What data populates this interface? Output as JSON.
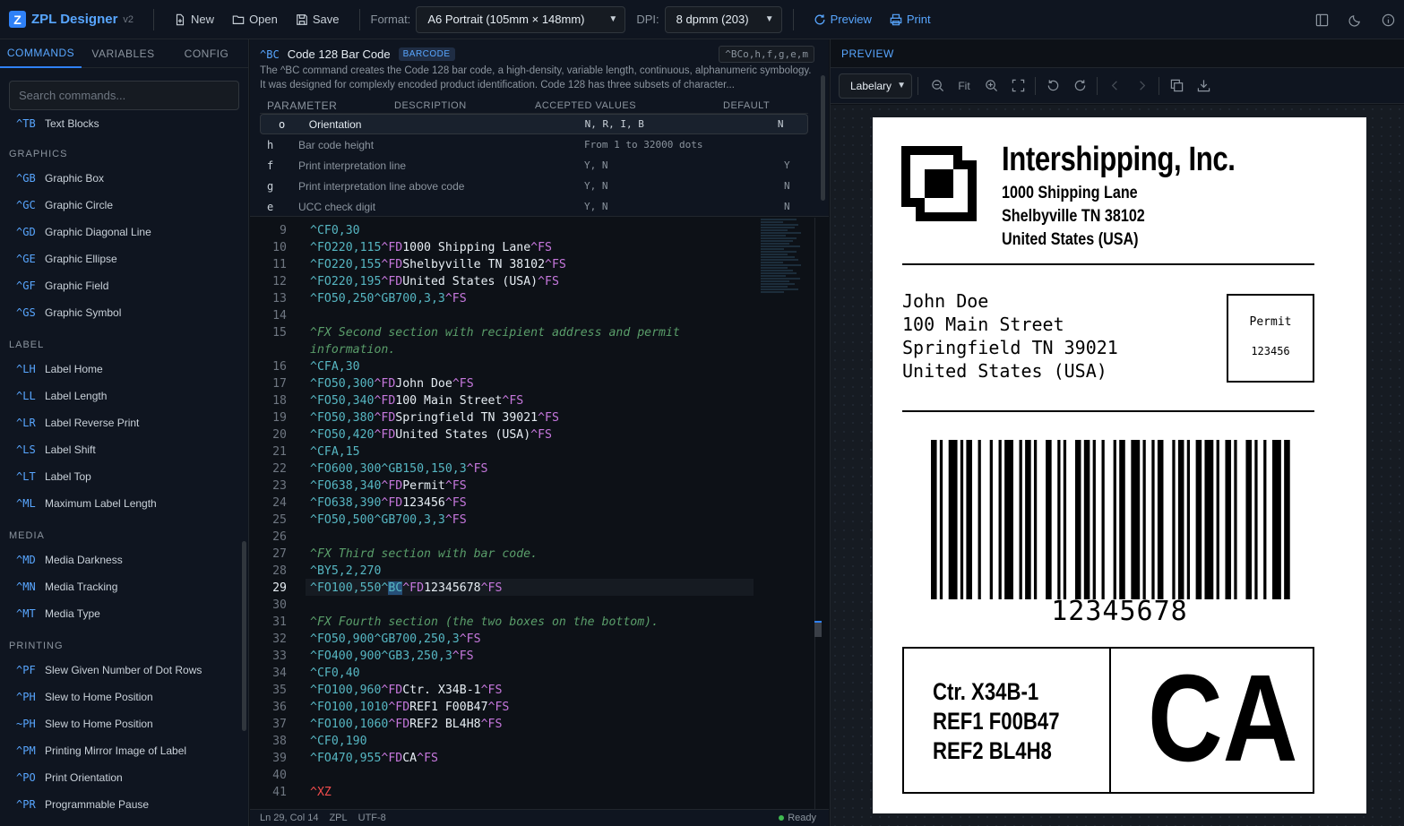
{
  "app": {
    "name": "ZPL Designer",
    "version": "v2"
  },
  "toolbar": {
    "new": "New",
    "open": "Open",
    "save": "Save",
    "format_label": "Format:",
    "format_value": "A6 Portrait (105mm × 148mm)",
    "dpi_label": "DPI:",
    "dpi_value": "8 dpmm (203)",
    "preview": "Preview",
    "print": "Print"
  },
  "sidebar": {
    "tabs": [
      "COMMANDS",
      "VARIABLES",
      "CONFIG"
    ],
    "search_placeholder": "Search commands...",
    "top_item": {
      "code": "^TB",
      "name": "Text Blocks"
    },
    "sections": [
      {
        "title": "GRAPHICS",
        "items": [
          {
            "code": "^GB",
            "name": "Graphic Box"
          },
          {
            "code": "^GC",
            "name": "Graphic Circle"
          },
          {
            "code": "^GD",
            "name": "Graphic Diagonal Line"
          },
          {
            "code": "^GE",
            "name": "Graphic Ellipse"
          },
          {
            "code": "^GF",
            "name": "Graphic Field"
          },
          {
            "code": "^GS",
            "name": "Graphic Symbol"
          }
        ]
      },
      {
        "title": "LABEL",
        "items": [
          {
            "code": "^LH",
            "name": "Label Home"
          },
          {
            "code": "^LL",
            "name": "Label Length"
          },
          {
            "code": "^LR",
            "name": "Label Reverse Print"
          },
          {
            "code": "^LS",
            "name": "Label Shift"
          },
          {
            "code": "^LT",
            "name": "Label Top"
          },
          {
            "code": "^ML",
            "name": "Maximum Label Length"
          }
        ]
      },
      {
        "title": "MEDIA",
        "items": [
          {
            "code": "^MD",
            "name": "Media Darkness"
          },
          {
            "code": "^MN",
            "name": "Media Tracking"
          },
          {
            "code": "^MT",
            "name": "Media Type"
          }
        ]
      },
      {
        "title": "PRINTING",
        "items": [
          {
            "code": "^PF",
            "name": "Slew Given Number of Dot Rows"
          },
          {
            "code": "^PH",
            "name": "Slew to Home Position"
          },
          {
            "code": "~PH",
            "name": "Slew to Home Position"
          },
          {
            "code": "^PM",
            "name": "Printing Mirror Image of Label"
          },
          {
            "code": "^PO",
            "name": "Print Orientation"
          },
          {
            "code": "^PR",
            "name": "Programmable Pause"
          }
        ]
      }
    ]
  },
  "doc": {
    "code": "^BC",
    "title": "Code 128 Bar Code",
    "badge": "BARCODE",
    "signature": "^BCo,h,f,g,e,m",
    "description": "The ^BC command creates the Code 128 bar code, a high-density, variable length, continuous, alphanumeric symbology. It was designed for complexly encoded product identification. Code 128 has three subsets of character...",
    "headers": [
      "PARAMETER",
      "DESCRIPTION",
      "ACCEPTED VALUES",
      "DEFAULT"
    ],
    "params": [
      {
        "p": "o",
        "d": "Orientation",
        "v": "N, R, I, B",
        "def": "N"
      },
      {
        "p": "h",
        "d": "Bar code height",
        "v": "From 1 to 32000 dots",
        "def": ""
      },
      {
        "p": "f",
        "d": "Print interpretation line",
        "v": "Y, N",
        "def": "Y"
      },
      {
        "p": "g",
        "d": "Print interpretation line above code",
        "v": "Y, N",
        "def": "N"
      },
      {
        "p": "e",
        "d": "UCC check digit",
        "v": "Y, N",
        "def": "N"
      }
    ]
  },
  "editor": {
    "lines": [
      {
        "n": "9",
        "segs": [
          [
            "kw",
            "^CF0,30"
          ]
        ]
      },
      {
        "n": "10",
        "segs": [
          [
            "kw",
            "^FO220,115"
          ],
          [
            "tk",
            "^FD"
          ],
          [
            "nm",
            "1000 Shipping Lane"
          ],
          [
            "tk",
            "^FS"
          ]
        ]
      },
      {
        "n": "11",
        "segs": [
          [
            "kw",
            "^FO220,155"
          ],
          [
            "tk",
            "^FD"
          ],
          [
            "nm",
            "Shelbyville TN 38102"
          ],
          [
            "tk",
            "^FS"
          ]
        ]
      },
      {
        "n": "12",
        "segs": [
          [
            "kw",
            "^FO220,195"
          ],
          [
            "tk",
            "^FD"
          ],
          [
            "nm",
            "United States (USA)"
          ],
          [
            "tk",
            "^FS"
          ]
        ]
      },
      {
        "n": "13",
        "segs": [
          [
            "kw",
            "^FO50,250^GB700,3,3"
          ],
          [
            "tk",
            "^FS"
          ]
        ]
      },
      {
        "n": "14",
        "segs": []
      },
      {
        "n": "15",
        "segs": [
          [
            "cm",
            "^FX Second section with recipient address and permit"
          ]
        ]
      },
      {
        "n": "",
        "segs": [
          [
            "cm",
            "information."
          ]
        ]
      },
      {
        "n": "16",
        "segs": [
          [
            "kw",
            "^CFA,30"
          ]
        ]
      },
      {
        "n": "17",
        "segs": [
          [
            "kw",
            "^FO50,300"
          ],
          [
            "tk",
            "^FD"
          ],
          [
            "nm",
            "John Doe"
          ],
          [
            "tk",
            "^FS"
          ]
        ]
      },
      {
        "n": "18",
        "segs": [
          [
            "kw",
            "^FO50,340"
          ],
          [
            "tk",
            "^FD"
          ],
          [
            "nm",
            "100 Main Street"
          ],
          [
            "tk",
            "^FS"
          ]
        ]
      },
      {
        "n": "19",
        "segs": [
          [
            "kw",
            "^FO50,380"
          ],
          [
            "tk",
            "^FD"
          ],
          [
            "nm",
            "Springfield TN 39021"
          ],
          [
            "tk",
            "^FS"
          ]
        ]
      },
      {
        "n": "20",
        "segs": [
          [
            "kw",
            "^FO50,420"
          ],
          [
            "tk",
            "^FD"
          ],
          [
            "nm",
            "United States (USA)"
          ],
          [
            "tk",
            "^FS"
          ]
        ]
      },
      {
        "n": "21",
        "segs": [
          [
            "kw",
            "^CFA,15"
          ]
        ]
      },
      {
        "n": "22",
        "segs": [
          [
            "kw",
            "^FO600,300^GB150,150,3"
          ],
          [
            "tk",
            "^FS"
          ]
        ]
      },
      {
        "n": "23",
        "segs": [
          [
            "kw",
            "^FO638,340"
          ],
          [
            "tk",
            "^FD"
          ],
          [
            "nm",
            "Permit"
          ],
          [
            "tk",
            "^FS"
          ]
        ]
      },
      {
        "n": "24",
        "segs": [
          [
            "kw",
            "^FO638,390"
          ],
          [
            "tk",
            "^FD"
          ],
          [
            "nm",
            "123456"
          ],
          [
            "tk",
            "^FS"
          ]
        ]
      },
      {
        "n": "25",
        "segs": [
          [
            "kw",
            "^FO50,500^GB700,3,3"
          ],
          [
            "tk",
            "^FS"
          ]
        ]
      },
      {
        "n": "26",
        "segs": []
      },
      {
        "n": "27",
        "segs": [
          [
            "cm",
            "^FX Third section with bar code."
          ]
        ]
      },
      {
        "n": "28",
        "segs": [
          [
            "kw",
            "^BY5,2,270"
          ]
        ]
      },
      {
        "n": "29",
        "segs": [
          [
            "kw",
            "^FO100,550^"
          ],
          [
            "kw",
            "BC"
          ],
          [
            "tk",
            "^FD"
          ],
          [
            "nm",
            "12345678"
          ],
          [
            "tk",
            "^FS"
          ]
        ],
        "current": true
      },
      {
        "n": "30",
        "segs": []
      },
      {
        "n": "31",
        "segs": [
          [
            "cm",
            "^FX Fourth section (the two boxes on the bottom)."
          ]
        ]
      },
      {
        "n": "32",
        "segs": [
          [
            "kw",
            "^FO50,900^GB700,250,3"
          ],
          [
            "tk",
            "^FS"
          ]
        ]
      },
      {
        "n": "33",
        "segs": [
          [
            "kw",
            "^FO400,900^GB3,250,3"
          ],
          [
            "tk",
            "^FS"
          ]
        ]
      },
      {
        "n": "34",
        "segs": [
          [
            "kw",
            "^CF0,40"
          ]
        ]
      },
      {
        "n": "35",
        "segs": [
          [
            "kw",
            "^FO100,960"
          ],
          [
            "tk",
            "^FD"
          ],
          [
            "nm",
            "Ctr. X34B-1"
          ],
          [
            "tk",
            "^FS"
          ]
        ]
      },
      {
        "n": "36",
        "segs": [
          [
            "kw",
            "^FO100,1010"
          ],
          [
            "tk",
            "^FD"
          ],
          [
            "nm",
            "REF1 F00B47"
          ],
          [
            "tk",
            "^FS"
          ]
        ]
      },
      {
        "n": "37",
        "segs": [
          [
            "kw",
            "^FO100,1060"
          ],
          [
            "tk",
            "^FD"
          ],
          [
            "nm",
            "REF2 BL4H8"
          ],
          [
            "tk",
            "^FS"
          ]
        ]
      },
      {
        "n": "38",
        "segs": [
          [
            "kw",
            "^CF0,190"
          ]
        ]
      },
      {
        "n": "39",
        "segs": [
          [
            "kw",
            "^FO470,955"
          ],
          [
            "tk",
            "^FD"
          ],
          [
            "nm",
            "CA"
          ],
          [
            "tk",
            "^FS"
          ]
        ]
      },
      {
        "n": "40",
        "segs": []
      },
      {
        "n": "41",
        "segs": [
          [
            "er",
            "^XZ"
          ]
        ]
      }
    ]
  },
  "status": {
    "position": "Ln 29, Col 14",
    "lang": "ZPL",
    "encoding": "UTF-8",
    "state": "Ready"
  },
  "preview": {
    "title": "PREVIEW",
    "renderer": "Labelary",
    "fit": "Fit",
    "label": {
      "company": "Intershipping, Inc.",
      "sender": [
        "1000 Shipping Lane",
        "Shelbyville TN 38102",
        "United States (USA)"
      ],
      "recipient": [
        "John Doe",
        "100 Main Street",
        "Springfield TN 39021",
        "United States (USA)"
      ],
      "permit_title": "Permit",
      "permit_number": "123456",
      "barcode_text": "12345678",
      "refs": [
        "Ctr. X34B-1",
        "REF1 F00B47",
        "REF2 BL4H8"
      ],
      "big_code": "CA"
    }
  }
}
